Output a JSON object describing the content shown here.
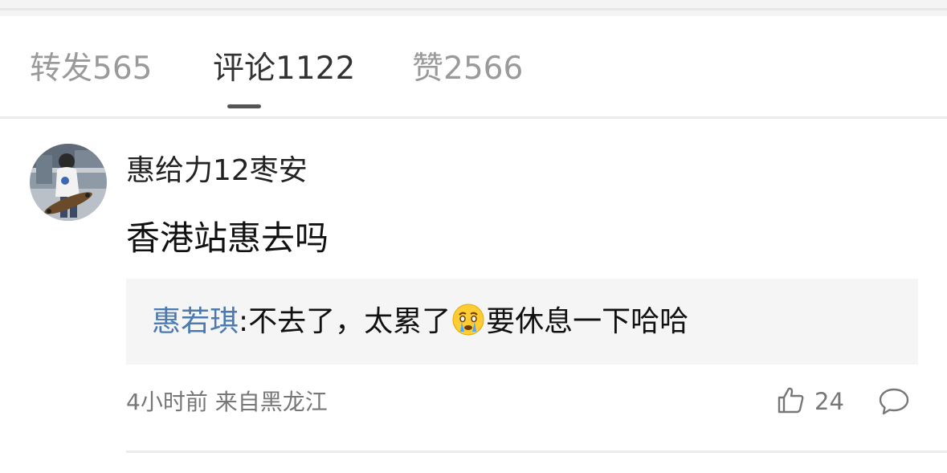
{
  "tabs": {
    "reposts_label": "转发565",
    "comments_label": "评论1122",
    "likes_label": "赞2566",
    "active": "comments"
  },
  "comment": {
    "username": "惠给力12枣安",
    "text": "香港站惠去吗",
    "reply": {
      "author": "惠若琪",
      "separator": ":",
      "text_before_emoji": "不去了，太累了",
      "emoji": "crying-face-emoji",
      "text_after_emoji": "要休息一下哈哈"
    },
    "meta": "4小时前 来自黑龙江",
    "like_count": "24",
    "icons": {
      "like": "thumbs-up-icon",
      "comment": "comment-bubble-icon"
    }
  },
  "colors": {
    "active_tab": "#333333",
    "inactive_tab": "#9a9a9a",
    "reply_author": "#4a7ab0",
    "reply_background": "#f5f5f5",
    "meta_text": "#777777"
  }
}
